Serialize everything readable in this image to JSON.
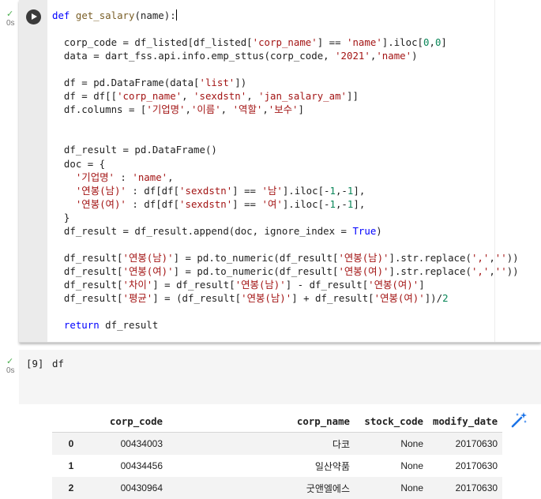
{
  "cell1": {
    "exec_time": "0s",
    "code_lines": [
      "def get_salary(name):",
      "",
      "  corp_code = df_listed[df_listed['corp_name'] == 'name'].iloc[0,0]",
      "  data = dart_fss.api.info.emp_sttus(corp_code, '2021','name')",
      "",
      "  df = pd.DataFrame(data['list'])",
      "  df = df[['corp_name', 'sexdstn', 'jan_salary_am']]",
      "  df.columns = ['기업명','이름', '역할','보수']",
      "",
      "",
      "  df_result = pd.DataFrame()",
      "  doc = {",
      "    '기업명' : 'name',",
      "    '연봉(남)' : df[df['sexdstn'] == '남'].iloc[-1,-1],",
      "    '연봉(여)' : df[df['sexdstn'] == '여'].iloc[-1,-1],",
      "  }",
      "  df_result = df_result.append(doc, ignore_index = True)",
      "",
      "  df_result['연봉(남)'] = pd.to_numeric(df_result['연봉(남)'].str.replace(',',''))",
      "  df_result['연봉(여)'] = pd.to_numeric(df_result['연봉(여)'].str.replace(',',''))",
      "  df_result['차이'] = df_result['연봉(남)'] - df_result['연봉(여)']",
      "  df_result['평균'] = (df_result['연봉(남)'] + df_result['연봉(여)'])/2",
      "",
      "  return df_result"
    ]
  },
  "cell2": {
    "exec_time": "0s",
    "prompt": "[9]",
    "source": "df"
  },
  "output_table": {
    "columns": [
      "",
      "corp_code",
      "corp_name",
      "stock_code",
      "modify_date"
    ],
    "rows": [
      {
        "index": "0",
        "corp_code": "00434003",
        "corp_name": "다코",
        "stock_code": "None",
        "modify_date": "20170630"
      },
      {
        "index": "1",
        "corp_code": "00434456",
        "corp_name": "일산약품",
        "stock_code": "None",
        "modify_date": "20170630"
      },
      {
        "index": "2",
        "corp_code": "00430964",
        "corp_name": "굿앤엘에스",
        "stock_code": "None",
        "modify_date": "20170630"
      }
    ]
  },
  "icons": {
    "run": "play-icon",
    "status": "check-icon",
    "suggest": "magic-wand-icon"
  },
  "colors": {
    "keyword": "#0000ff",
    "function": "#795e26",
    "string": "#a31515",
    "number": "#098658",
    "success": "#4caf50"
  }
}
